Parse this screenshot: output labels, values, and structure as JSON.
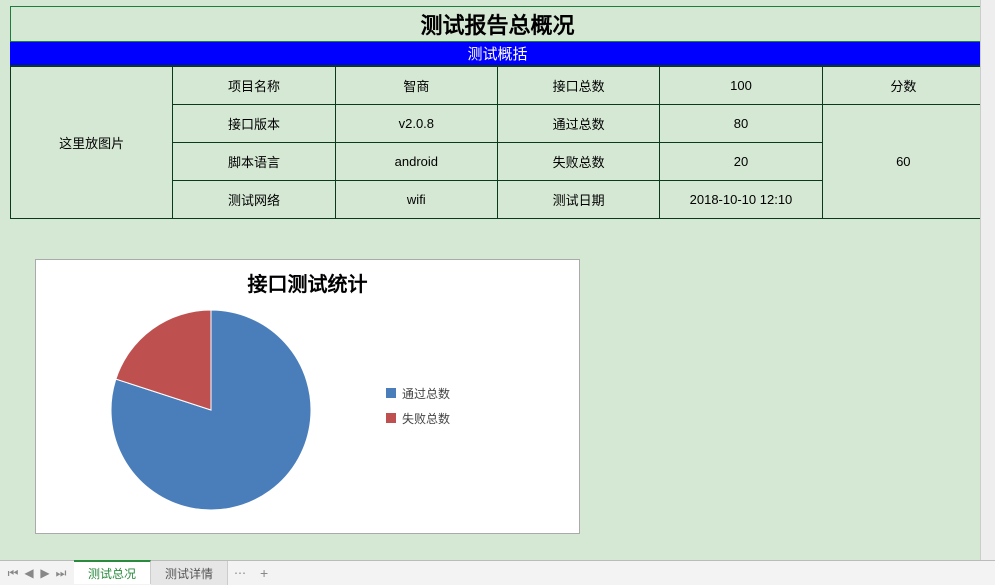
{
  "header": {
    "title": "测试报告总概况",
    "subtitle": "测试概括"
  },
  "table": {
    "image_placeholder": "这里放图片",
    "rows": [
      {
        "label1": "项目名称",
        "value1": "智商",
        "label2": "接口总数",
        "value2": "100"
      },
      {
        "label1": "接口版本",
        "value1": "v2.0.8",
        "label2": "通过总数",
        "value2": "80"
      },
      {
        "label1": "脚本语言",
        "value1": "android",
        "label2": "失败总数",
        "value2": "20"
      },
      {
        "label1": "测试网络",
        "value1": "wifi",
        "label2": "测试日期",
        "value2": "2018-10-10 12:10"
      }
    ],
    "score_label": "分数",
    "score_value": "60"
  },
  "chart_data": {
    "type": "pie",
    "title": "接口测试统计",
    "series": [
      {
        "name": "通过总数",
        "value": 80,
        "color": "#4a7ebb"
      },
      {
        "name": "失败总数",
        "value": 20,
        "color": "#be5150"
      }
    ]
  },
  "tabs": {
    "active": "测试总况",
    "items": [
      "测试总况",
      "测试详情"
    ]
  }
}
